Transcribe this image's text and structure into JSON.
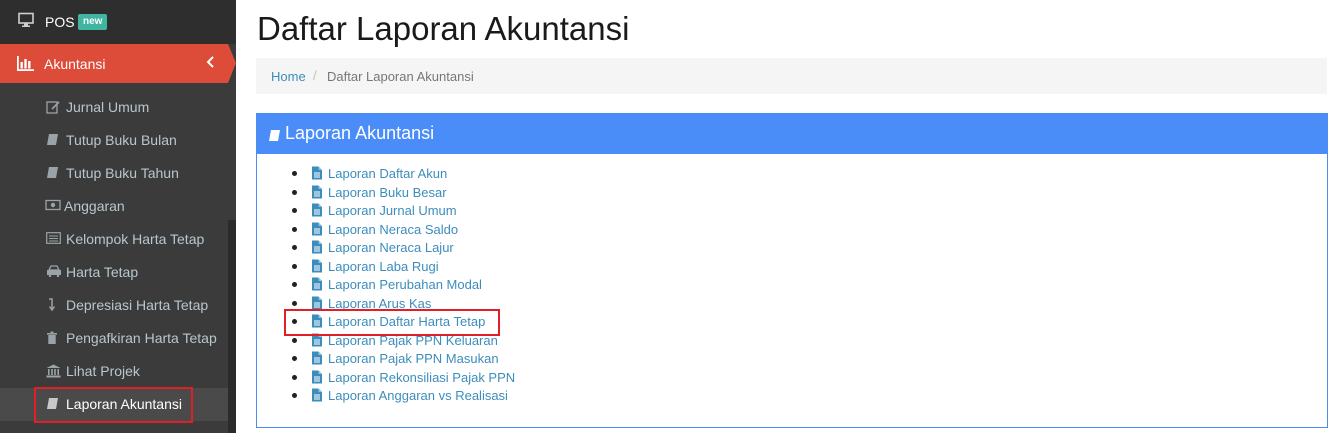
{
  "sidebar": {
    "top_item": {
      "label": "POS",
      "badge": "new",
      "icon": "desktop-icon"
    },
    "active_item": {
      "label": "Akuntansi",
      "icon": "bar-chart-icon",
      "chevron": "‹"
    },
    "sub_items": [
      {
        "label": "Jurnal Umum",
        "icon": "edit-icon"
      },
      {
        "label": "Tutup Buku Bulan",
        "icon": "book-icon"
      },
      {
        "label": "Tutup Buku Tahun",
        "icon": "book-icon"
      },
      {
        "label": "Anggaran",
        "icon": "money-icon"
      },
      {
        "label": "Kelompok Harta Tetap",
        "icon": "list-icon"
      },
      {
        "label": "Harta Tetap",
        "icon": "car-icon"
      },
      {
        "label": "Depresiasi Harta Tetap",
        "icon": "level-down-icon"
      },
      {
        "label": "Pengafkiran Harta Tetap",
        "icon": "trash-icon"
      },
      {
        "label": "Lihat Projek",
        "icon": "bank-icon"
      },
      {
        "label": "Laporan Akuntansi",
        "icon": "book-icon"
      }
    ]
  },
  "page": {
    "title": "Daftar Laporan Akuntansi"
  },
  "breadcrumb": {
    "home": "Home",
    "separator": "/",
    "current": "Daftar Laporan Akuntansi"
  },
  "panel": {
    "title": "Laporan Akuntansi",
    "items": [
      "Laporan Daftar Akun",
      "Laporan Buku Besar",
      "Laporan Jurnal Umum",
      "Laporan Neraca Saldo",
      "Laporan Neraca Lajur",
      "Laporan Laba Rugi",
      "Laporan Perubahan Modal",
      "Laporan Arus Kas",
      "Laporan Daftar Harta Tetap",
      "Laporan Pajak PPN Keluaran",
      "Laporan Pajak PPN Masukan",
      "Laporan Rekonsiliasi Pajak PPN",
      "Laporan Anggaran vs Realisasi"
    ]
  },
  "colors": {
    "sidebar_bg": "#3b3b3b",
    "active_red": "#dd4b39",
    "panel_blue": "#4b8df8",
    "link_blue": "#3c8dbc",
    "highlight_red": "#e01f26"
  }
}
